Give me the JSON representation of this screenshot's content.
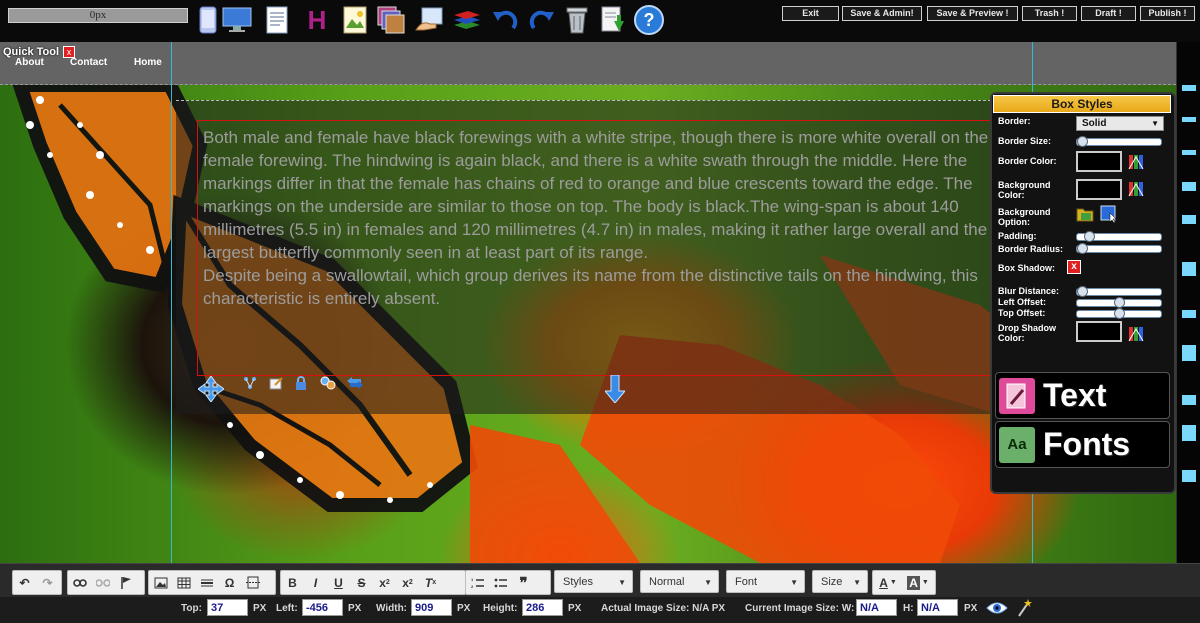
{
  "topbar": {
    "px_value": "0px",
    "tool_icons": [
      "mobile-icon",
      "desktop-icon",
      "page-icon",
      "heading-icon",
      "image-icon",
      "gallery-icon",
      "hand-image-icon",
      "layers-icon",
      "undo-icon",
      "redo-icon",
      "trash-can-icon",
      "download-page-icon",
      "help-icon"
    ],
    "heading_glyph": "H",
    "help_glyph": "?",
    "buttons": {
      "exit": "Exit",
      "save_admin": "Save & Admin!",
      "save_preview": "Save & Preview !",
      "trash": "Trash !",
      "draft": "Draft !",
      "publish": "Publish !"
    }
  },
  "quick_tool": {
    "label": "Quick Tool",
    "close": "x"
  },
  "nav": {
    "about": "About",
    "contact": "Contact",
    "home": "Home"
  },
  "content": {
    "paragraph1": "Both male and female have black forewings with a white stripe, though there is more white overall on the female forewing. The hindwing is again black, and there is a white swath through the middle. Here the markings differ in that the female has chains of red to orange and blue crescents toward the edge. The markings on the underside are similar to those on top. The body is black.The wing-span is about 140 millimetres (5.5 in) in females and 120 millimetres (4.7 in) in males, making it rather large overall and the largest butterfly commonly seen in at least part of its range.",
    "paragraph2": "Despite being a swallowtail, which group derives its name from the distinctive tails on the hindwing, this characteristic is entirely absent."
  },
  "box_styles": {
    "title": "Box Styles",
    "border_label": "Border:",
    "border_value": "Solid",
    "border_size_label": "Border Size:",
    "border_color_label": "Border Color:",
    "background_color_label": "Background Color:",
    "background_option_label": "Background Option:",
    "padding_label": "Padding:",
    "border_radius_label": "Border Radius:",
    "box_shadow_label": "Box Shadow:",
    "blur_distance_label": "Blur Distance:",
    "left_offset_label": "Left Offset:",
    "top_offset_label": "Top Offset:",
    "drop_shadow_color_label": "Drop Shadow Color:",
    "sliders": {
      "border_size": 0.0,
      "padding": 0.1,
      "border_radius": 0.0,
      "blur_distance": 0.0,
      "left_offset": 0.5,
      "top_offset": 0.5
    },
    "box_shadow_toggle": "x"
  },
  "panels": {
    "text": "Text",
    "fonts": "Fonts",
    "fonts_icon_glyph": "Aa"
  },
  "editor": {
    "styles": "Styles",
    "format": "Normal",
    "font": "Font",
    "size": "Size",
    "text_color": "A",
    "bg_color": "A",
    "bold": "B",
    "italic": "I",
    "underline": "U",
    "strike": "S",
    "subscript": "x",
    "superscript": "x",
    "omega": "Ω",
    "quote": "❞",
    "clear_format": "T"
  },
  "dimensions": {
    "top_label": "Top:",
    "top_value": "37",
    "left_label": "Left:",
    "left_value": "-456",
    "width_label": "Width:",
    "width_value": "909",
    "height_label": "Height:",
    "height_value": "286",
    "px": "PX",
    "actual_size": "Actual Image Size: N/A PX",
    "current_size_label": "Current Image Size: W:",
    "current_w": "N/A",
    "h_label": "H:",
    "current_h": "N/A"
  }
}
